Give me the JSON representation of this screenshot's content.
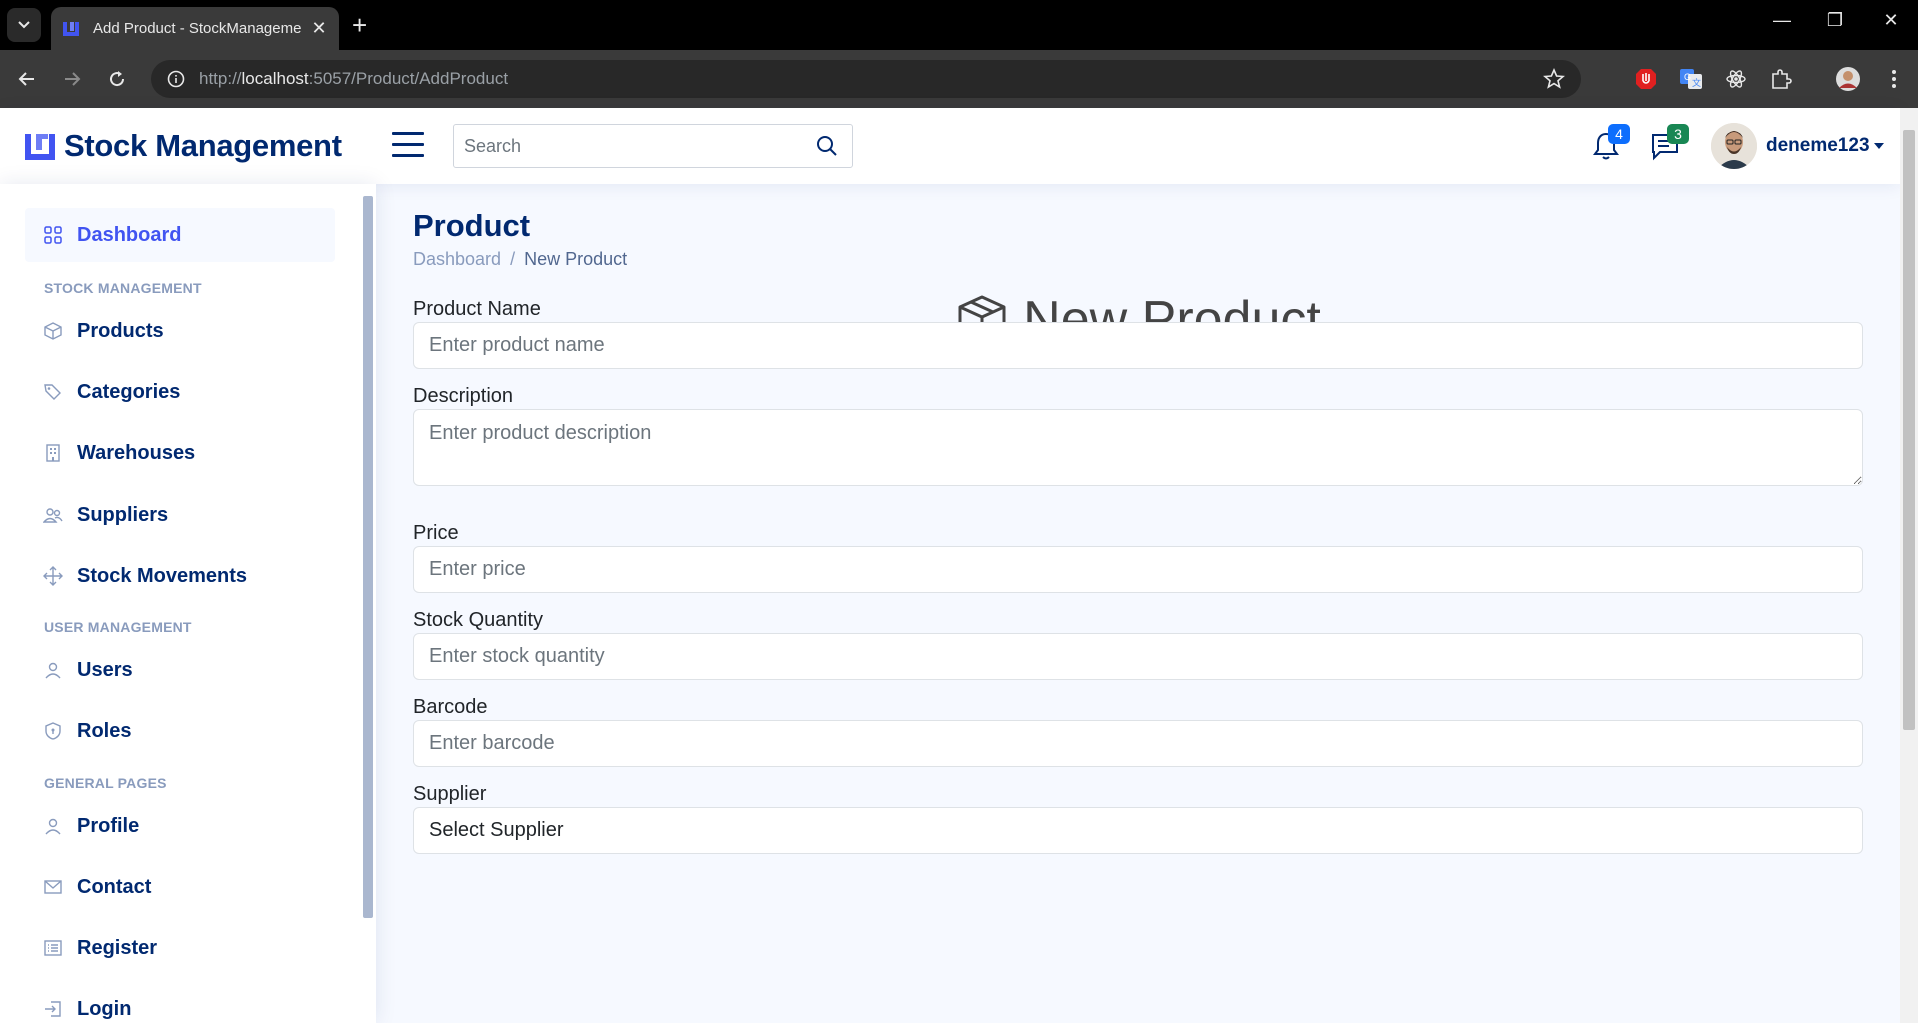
{
  "browser": {
    "tab_title": "Add Product - StockManageme",
    "url_scheme": "http://",
    "url_host": "localhost",
    "url_rest": ":5057/Product/AddProduct"
  },
  "header": {
    "brand": "Stock Management",
    "search_placeholder": "Search",
    "notifications_count": "4",
    "messages_count": "3",
    "username": "deneme123"
  },
  "sidebar": {
    "dashboard": "Dashboard",
    "section_stock": "STOCK MANAGEMENT",
    "products": "Products",
    "categories": "Categories",
    "warehouses": "Warehouses",
    "suppliers": "Suppliers",
    "stock_movements": "Stock Movements",
    "section_user": "USER MANAGEMENT",
    "users": "Users",
    "roles": "Roles",
    "section_general": "GENERAL PAGES",
    "profile": "Profile",
    "contact": "Contact",
    "register": "Register",
    "login": "Login"
  },
  "main": {
    "page_title": "Product",
    "breadcrumb_home": "Dashboard",
    "breadcrumb_current": "New Product",
    "form_title": "New Product",
    "fields": {
      "name_label": "Product Name",
      "name_placeholder": "Enter product name",
      "description_label": "Description",
      "description_placeholder": "Enter product description",
      "price_label": "Price",
      "price_placeholder": "Enter price",
      "stock_label": "Stock Quantity",
      "stock_placeholder": "Enter stock quantity",
      "barcode_label": "Barcode",
      "barcode_placeholder": "Enter barcode",
      "supplier_label": "Supplier",
      "supplier_value": "Select Supplier"
    }
  },
  "colors": {
    "brand": "#012970",
    "accent": "#4154f1",
    "muted": "#899bbd",
    "background": "#f6f9ff"
  }
}
